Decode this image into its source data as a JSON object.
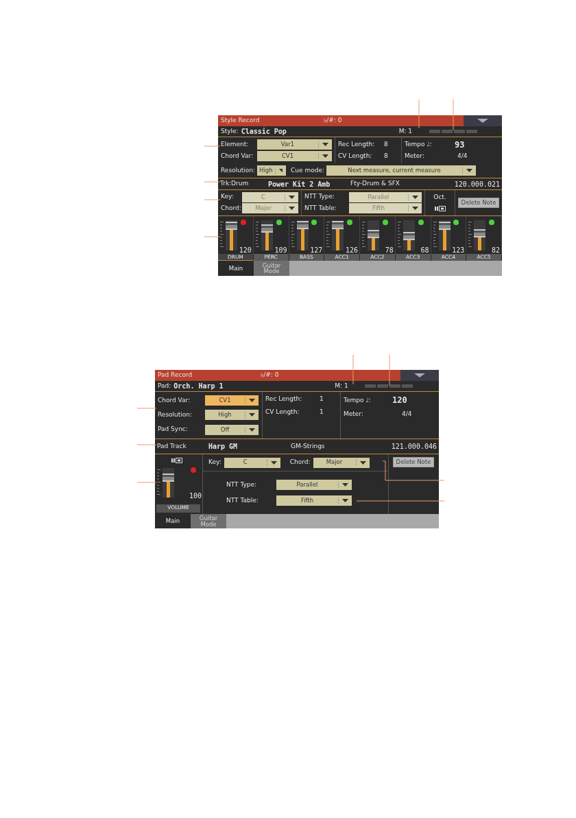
{
  "style_record": {
    "title": "Style Record",
    "accidentals": "♭/#: 0",
    "info": {
      "label": "Style:",
      "value": "Classic Pop",
      "measure": "M: 1"
    },
    "left_fields": [
      {
        "label": "Element:",
        "value": "Var1",
        "disabled": false,
        "selected": false
      },
      {
        "label": "Chord Var:",
        "value": "CV1",
        "disabled": false,
        "selected": false
      }
    ],
    "lengths": [
      {
        "label": "Rec Length:",
        "value": "8"
      },
      {
        "label": "CV Length:",
        "value": "8"
      }
    ],
    "tempo": {
      "label": "Tempo ♩:",
      "value": "93"
    },
    "meter": {
      "label": "Meter:",
      "value": "4/4"
    },
    "resolution": {
      "label": "Resolution:",
      "value": "High",
      "disabled": false,
      "selected": false
    },
    "cue_mode": {
      "label": "Cue mode:",
      "value": "Next measure, current measure",
      "disabled": false,
      "selected": false
    },
    "track": {
      "label": "Trk:Drum",
      "sound": "Power Kit 2 Amb",
      "bank": "Fty-Drum & SFX",
      "number": "120.000.021"
    },
    "key_fields": [
      {
        "label": "Key:",
        "value": "C",
        "disabled": true,
        "selected": false
      },
      {
        "label": "Chord:",
        "value": "Major",
        "disabled": true,
        "selected": false
      }
    ],
    "ntt_fields": [
      {
        "label": "NTT Type:",
        "value": "Parallel",
        "disabled": true,
        "selected": false
      },
      {
        "label": "NTT Table:",
        "value": "Fifth",
        "disabled": true,
        "selected": false
      }
    ],
    "octave_label": "Oct.",
    "delete_button": "Delete Note",
    "channels": [
      {
        "name": "DRUM",
        "value": "120",
        "level": 0.94,
        "color": "#e02020",
        "selected": true
      },
      {
        "name": "PERC",
        "value": "109",
        "level": 0.82,
        "color": "#50d040",
        "selected": false
      },
      {
        "name": "BASS",
        "value": "127",
        "level": 0.97,
        "color": "#50d040",
        "selected": false
      },
      {
        "name": "ACC1",
        "value": "126",
        "level": 0.96,
        "color": "#50d040",
        "selected": false
      },
      {
        "name": "ACC2",
        "value": "78",
        "level": 0.55,
        "color": "#50d040",
        "selected": false
      },
      {
        "name": "ACC3",
        "value": "68",
        "level": 0.48,
        "color": "#50d040",
        "selected": false
      },
      {
        "name": "ACC4",
        "value": "123",
        "level": 0.94,
        "color": "#50d040",
        "selected": false
      },
      {
        "name": "ACC5",
        "value": "82",
        "level": 0.6,
        "color": "#50d040",
        "selected": false
      }
    ],
    "tabs": [
      {
        "label": "Main",
        "selected": true
      },
      {
        "label": "Guitar Mode",
        "selected": false
      }
    ]
  },
  "pad_record": {
    "title": "Pad Record",
    "accidentals": "♭/#: 0",
    "info": {
      "label": "Pad:",
      "value": "Orch. Harp 1",
      "measure": "M: 1"
    },
    "left_fields": [
      {
        "label": "Chord Var:",
        "value": "CV1",
        "disabled": false,
        "selected": true
      },
      {
        "label": "Resolution:",
        "value": "High",
        "disabled": false,
        "selected": false
      },
      {
        "label": "Pad Sync:",
        "value": "Off",
        "disabled": false,
        "selected": false
      }
    ],
    "lengths": [
      {
        "label": "Rec Length:",
        "value": "1"
      },
      {
        "label": "CV Length:",
        "value": "1"
      }
    ],
    "tempo": {
      "label": "Tempo ♩:",
      "value": "120"
    },
    "meter": {
      "label": "Meter:",
      "value": "4/4"
    },
    "track": {
      "label": "Pad Track",
      "sound": "Harp GM",
      "bank": "GM-Strings",
      "number": "121.000.046"
    },
    "volume": {
      "name": "VOLUME",
      "value": "100",
      "level": 0.75,
      "color": "#e02020"
    },
    "key_fields": [
      {
        "label": "Key:",
        "value": "C",
        "disabled": false,
        "selected": false
      },
      {
        "label": "Chord:",
        "value": "Major",
        "disabled": false,
        "selected": false
      }
    ],
    "ntt_fields": [
      {
        "label": "NTT Type:",
        "value": "Parallel",
        "disabled": false,
        "selected": false
      },
      {
        "label": "NTT Table:",
        "value": "Fifth",
        "disabled": false,
        "selected": false
      }
    ],
    "delete_button": "Delete Note",
    "tabs": [
      {
        "label": "Main",
        "selected": true
      },
      {
        "label": "Guitar Mode",
        "selected": false
      }
    ]
  }
}
